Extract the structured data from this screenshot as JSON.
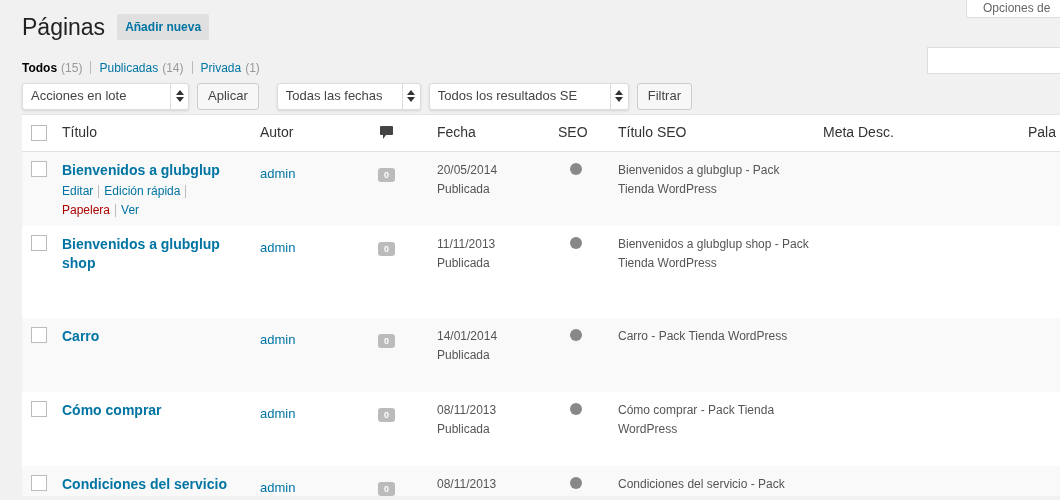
{
  "screen_options": "Opciones de",
  "title": "Páginas",
  "add_new": "Añadir nueva",
  "filters": [
    {
      "label": "Todos",
      "count": "(15)",
      "selected": true
    },
    {
      "label": "Publicadas",
      "count": "(14)",
      "selected": false
    },
    {
      "label": "Privada",
      "count": "(1)",
      "selected": false
    }
  ],
  "bulk_actions": {
    "value": "Acciones en lote",
    "button": "Aplicar"
  },
  "date_filter": {
    "value": "Todas las fechas"
  },
  "seo_filter": {
    "value": "Todos los resultados SE"
  },
  "filter_button": "Filtrar",
  "table": {
    "select_all_checked": false,
    "columns": [
      "Título",
      "Autor",
      "",
      "Fecha",
      "SEO",
      "Título SEO",
      "Meta Desc.",
      "Pala"
    ],
    "rows": [
      {
        "checked": false,
        "title": "Bienvenidos a glubglup",
        "actions": [
          {
            "label": "Editar",
            "kind": "link"
          },
          {
            "label": "Edición rápida",
            "kind": "link"
          },
          {
            "label": "Papelera",
            "kind": "delete"
          },
          {
            "label": "Ver",
            "kind": "link"
          }
        ],
        "author": "admin",
        "comments": "0",
        "date": "20/05/2014",
        "status": "Publicada",
        "seo": {
          "color": "#888888"
        },
        "seo_title": "Bienvenidos a glubglup - Pack Tienda WordPress"
      },
      {
        "checked": false,
        "title": "Bienvenidos a glubglup shop",
        "author": "admin",
        "comments": "0",
        "date": "11/11/2013",
        "status": "Publicada",
        "seo": {
          "color": "#888888"
        },
        "seo_title": "Bienvenidos a glubglup shop - Pack Tienda WordPress"
      },
      {
        "checked": false,
        "title": "Carro",
        "author": "admin",
        "comments": "0",
        "date": "14/01/2014",
        "status": "Publicada",
        "seo": {
          "color": "#888888"
        },
        "seo_title": "Carro - Pack Tienda WordPress"
      },
      {
        "checked": false,
        "title": "Cómo comprar",
        "author": "admin",
        "comments": "0",
        "date": "08/11/2013",
        "status": "Publicada",
        "seo": {
          "color": "#888888"
        },
        "seo_title": "Cómo comprar - Pack Tienda WordPress"
      },
      {
        "checked": false,
        "title": "Condiciones del servicio",
        "author": "admin",
        "comments": "0",
        "date": "08/11/2013",
        "seo": {
          "color": "#888888"
        },
        "seo_title": "Condiciones del servicio - Pack"
      }
    ]
  }
}
